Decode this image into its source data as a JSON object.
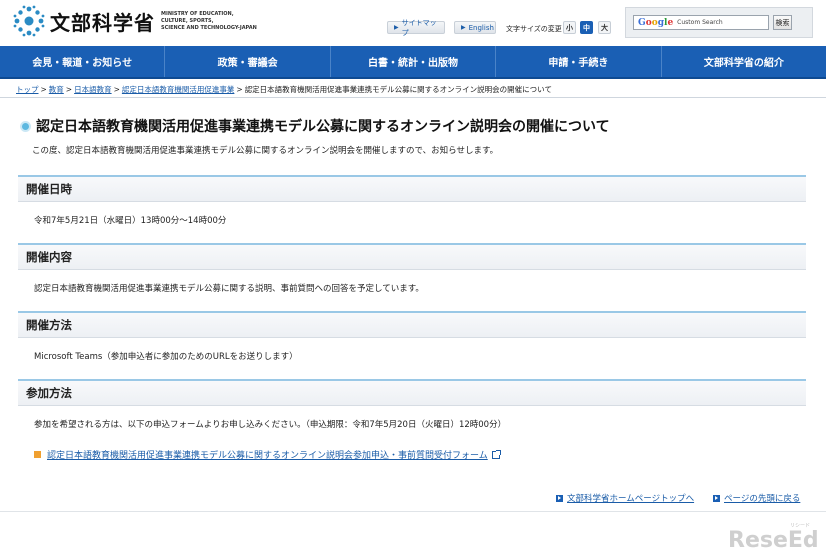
{
  "header": {
    "logo_title": "文部科学省",
    "logo_en": [
      "MINISTRY OF EDUCATION,",
      "CULTURE, SPORTS,",
      "SCIENCE AND TECHNOLOGY-JAPAN"
    ],
    "sitemap": "サイトマップ",
    "english": "English",
    "font_size_label": "文字サイズの変更",
    "font_small": "小",
    "font_medium": "中",
    "font_large": "大",
    "search_brand": "Google",
    "search_placeholder": "Custom Search",
    "search_button": "検索"
  },
  "nav": [
    "会見・報道・お知らせ",
    "政策・審議会",
    "白書・統計・出版物",
    "申請・手続き",
    "文部科学省の紹介"
  ],
  "breadcrumb": {
    "links": [
      "トップ",
      "教育",
      "日本語教育",
      "認定日本語教育機関活用促進事業"
    ],
    "current": "認定日本語教育機関活用促進事業連携モデル公募に関するオンライン説明会の開催について"
  },
  "page": {
    "title": "認定日本語教育機関活用促進事業連携モデル公募に関するオンライン説明会の開催について",
    "intro": "この度、認定日本語教育機関活用促進事業連携モデル公募に関するオンライン説明会を開催しますので、お知らせします。"
  },
  "sections": [
    {
      "heading": "開催日時",
      "body": "令和7年5月21日（水曜日）13時00分～14時00分"
    },
    {
      "heading": "開催内容",
      "body": "認定日本語教育機関活用促進事業連携モデル公募に関する説明、事前質問への回答を予定しています。"
    },
    {
      "heading": "開催方法",
      "body": "Microsoft Teams（参加申込者に参加のためのURLをお送りします）"
    },
    {
      "heading": "参加方法",
      "body": "参加を希望される方は、以下の申込フォームよりお申し込みください。（申込期限：令和7年5月20日（火曜日）12時00分）"
    }
  ],
  "form_link": "認定日本語教育機関活用促進事業連携モデル公募に関するオンライン説明会参加申込・事前質問受付フォーム",
  "footer": {
    "home_top": "文部科学省ホームページトップへ",
    "page_top": "ページの先頭に戻る"
  },
  "watermark": {
    "text": "ReseEd",
    "ruby": "リシード"
  },
  "colors": {
    "nav_bg": "#1a5fb4",
    "link": "#1a5ca8",
    "section_rule": "#9ac8e6",
    "form_bullet": "#f0a030"
  }
}
